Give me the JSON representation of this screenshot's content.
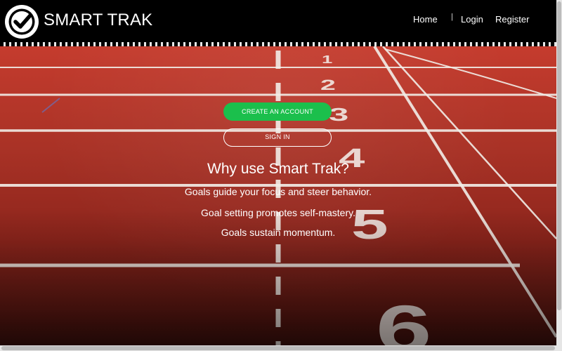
{
  "header": {
    "brand": "SMART TRAK",
    "logo_icon": "check-circle-icon",
    "nav": {
      "home": "Home",
      "separator": "|",
      "login": "Login",
      "register": "Register"
    }
  },
  "hero": {
    "lane_numbers": [
      "1",
      "2",
      "3",
      "4",
      "5",
      "6"
    ],
    "create_account_label": "CREATE AN ACCOUNT",
    "sign_in_label": "SIGN IN",
    "heading": "Why use Smart Trak?",
    "reasons": [
      "Goals guide your focus and steer behavior.",
      "Goal setting promotes self-mastery.",
      "Goals sustain momentum."
    ]
  },
  "colors": {
    "header_bg": "#000000",
    "track_red": "#b23a2d",
    "accent_green": "#1bbf4c",
    "text": "#ffffff"
  }
}
